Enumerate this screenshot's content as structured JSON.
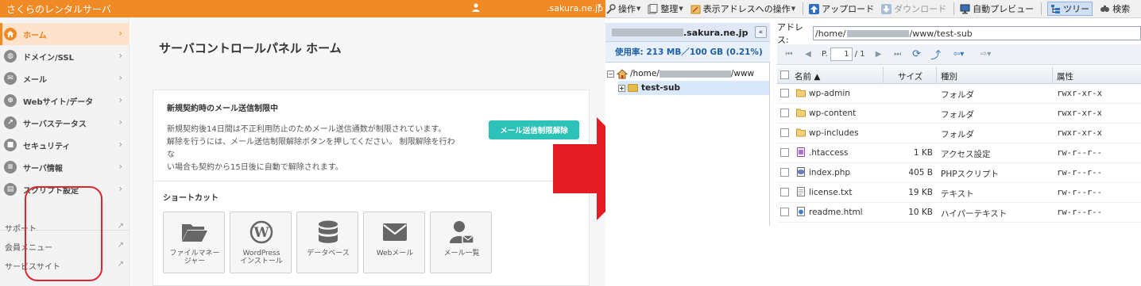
{
  "cp": {
    "brand": "さくらのレンタルサーバ",
    "account_domain": ".sakura.ne.jp",
    "nav": [
      {
        "label": "ホーム",
        "icon": "home-icon",
        "active": true
      },
      {
        "label": "ドメイン/SSL",
        "icon": "globe-icon"
      },
      {
        "label": "メール",
        "icon": "mail-icon"
      },
      {
        "label": "Webサイト/データ",
        "icon": "web-icon"
      },
      {
        "label": "サーバステータス",
        "icon": "chart-icon"
      },
      {
        "label": "セキュリティ",
        "icon": "lock-icon"
      },
      {
        "label": "サーバ情報",
        "icon": "server-icon"
      },
      {
        "label": "スクリプト設定",
        "icon": "script-icon"
      }
    ],
    "links": [
      {
        "label": "サポート"
      },
      {
        "label": "会員メニュー"
      },
      {
        "label": "サービスサイト"
      }
    ],
    "page_title": "サーバコントロールパネル ホーム",
    "notice": {
      "heading": "新規契約時のメール送信制限中",
      "line1": "新規契約後14日間は不正利用防止のためメール送信通数が制限されています。",
      "line2": "解除を行うには、メール送信制限解除ボタンを押してください。 制限解除を行わな",
      "line3": "い場合も契約から15日後に自動で解除されます。",
      "button": "メール送信制限解除"
    },
    "shortcuts": {
      "heading": "ショートカット",
      "items": [
        {
          "line1": "ファイルマネー",
          "line2": "ジャー",
          "icon": "folder-open-icon"
        },
        {
          "line1": "WordPress",
          "line2": "インストール",
          "icon": "wordpress-icon"
        },
        {
          "line1": "データベース",
          "line2": "",
          "icon": "database-icon"
        },
        {
          "line1": "Webメール",
          "line2": "",
          "icon": "envelope-icon"
        },
        {
          "line1": "メール一覧",
          "line2": "",
          "icon": "mail-user-icon"
        }
      ]
    }
  },
  "fm": {
    "menu": [
      {
        "label": "操作",
        "icon": "operate-icon",
        "dropdown": true
      },
      {
        "label": "整理",
        "icon": "organize-icon",
        "dropdown": true
      },
      {
        "label": "表示アドレスへの操作",
        "icon": "address-op-icon",
        "dropdown": true
      },
      {
        "label": "アップロード",
        "icon": "upload-icon"
      },
      {
        "label": "ダウンロード",
        "icon": "download-icon",
        "disabled": true
      },
      {
        "label": "自動プレビュー",
        "icon": "preview-icon"
      },
      {
        "label": "ツリー",
        "icon": "tree-icon",
        "active": true
      },
      {
        "label": "検索",
        "icon": "search-icon"
      }
    ],
    "tree_domain": ".sakura.ne.jp",
    "usage": "使用率: 213 MB／100 GB (0.21%)",
    "tree_root_prefix": "/home/",
    "tree_root_suffix": "/www",
    "tree_child": "test-sub",
    "address_label": "アドレス:",
    "address_prefix": "/home/",
    "address_suffix": "/www/test-sub",
    "page_label": "P.",
    "page_value": "1",
    "page_total": "/ 1",
    "columns": {
      "name": "名前 ▲",
      "size": "サイズ",
      "type": "種別",
      "perm": "属性"
    },
    "files": [
      {
        "name": "wp-admin",
        "size": "",
        "type": "フォルダ",
        "perm": "rwxr-xr-x",
        "icon": "folder-icon"
      },
      {
        "name": "wp-content",
        "size": "",
        "type": "フォルダ",
        "perm": "rwxr-xr-x",
        "icon": "folder-icon"
      },
      {
        "name": "wp-includes",
        "size": "",
        "type": "フォルダ",
        "perm": "rwxr-xr-x",
        "icon": "folder-icon"
      },
      {
        "name": ".htaccess",
        "size": "1 KB",
        "type": "アクセス設定",
        "perm": "rw-r--r--",
        "icon": "htaccess-icon"
      },
      {
        "name": "index.php",
        "size": "405 B",
        "type": "PHPスクリプト",
        "perm": "rw-r--r--",
        "icon": "php-icon"
      },
      {
        "name": "license.txt",
        "size": "19 KB",
        "type": "テキスト",
        "perm": "rw-r--r--",
        "icon": "text-file-icon"
      },
      {
        "name": "readme.html",
        "size": "10 KB",
        "type": "ハイパーテキスト",
        "perm": "rw-r--r--",
        "icon": "html-file-icon"
      }
    ]
  },
  "colors": {
    "brand_orange": "#f08a24",
    "teal": "#2cc2b7",
    "arrow_red": "#e31b23",
    "highlight_red": "#d9282f"
  }
}
